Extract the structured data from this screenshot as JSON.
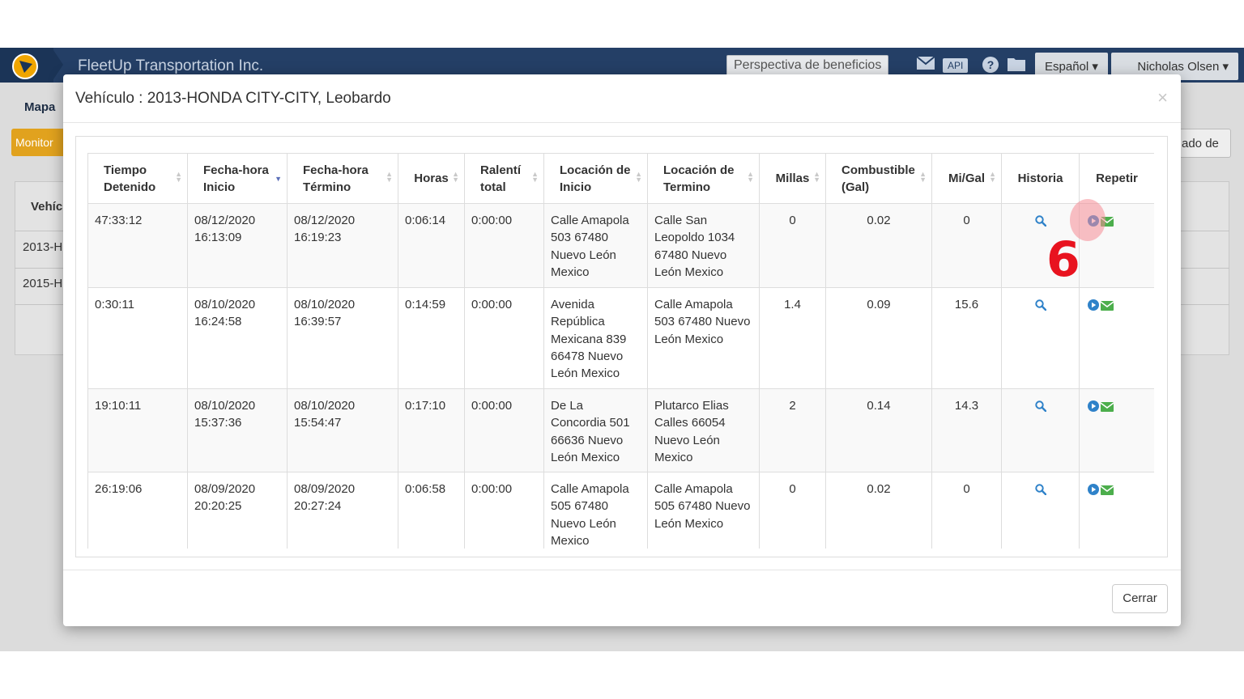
{
  "app": {
    "company": "FleetUp Transportation Inc.",
    "benefits_label": "Perspectiva de beneficios",
    "api_label": "API",
    "language": "Español",
    "user": "Nicholas Olsen",
    "tab_map": "Mapa",
    "monitor_btn": "Monitor",
    "right_btn": "ado de",
    "vehicle_col": "Vehíc",
    "rows": [
      "2013-H",
      "2015-H"
    ]
  },
  "modal": {
    "title": "Vehículo : 2013-HONDA CITY-CITY, Leobardo",
    "close_x": "×",
    "close_button": "Cerrar",
    "step_number": "6"
  },
  "table": {
    "headers": [
      "Tiempo Detenido",
      "Fecha-hora Inicio",
      "Fecha-hora Término",
      "Horas",
      "Ralentí total",
      "Locación de Inicio",
      "Locación de Termino",
      "Millas",
      "Combustible (Gal)",
      "Mi/Gal",
      "Historia",
      "Repetir"
    ],
    "rows": [
      {
        "stopped": "47:33:12",
        "start": "08/12/2020 16:13:09",
        "end": "08/12/2020 16:19:23",
        "hours": "0:06:14",
        "idle": "0:00:00",
        "start_loc": "Calle Amapola 503 67480 Nuevo León Mexico",
        "end_loc": "Calle San Leopoldo 1034 67480 Nuevo León Mexico",
        "miles": "0",
        "fuel": "0.02",
        "mpg": "0"
      },
      {
        "stopped": "0:30:11",
        "start": "08/10/2020 16:24:58",
        "end": "08/10/2020 16:39:57",
        "hours": "0:14:59",
        "idle": "0:00:00",
        "start_loc": "Avenida República Mexicana 839 66478 Nuevo León Mexico",
        "end_loc": "Calle Amapola 503 67480 Nuevo León Mexico",
        "miles": "1.4",
        "fuel": "0.09",
        "mpg": "15.6"
      },
      {
        "stopped": "19:10:11",
        "start": "08/10/2020 15:37:36",
        "end": "08/10/2020 15:54:47",
        "hours": "0:17:10",
        "idle": "0:00:00",
        "start_loc": "De La Concordia 501 66636 Nuevo León Mexico",
        "end_loc": "Plutarco Elias Calles 66054 Nuevo León Mexico",
        "miles": "2",
        "fuel": "0.14",
        "mpg": "14.3"
      },
      {
        "stopped": "26:19:06",
        "start": "08/09/2020 20:20:25",
        "end": "08/09/2020 20:27:24",
        "hours": "0:06:58",
        "idle": "0:00:00",
        "start_loc": "Calle Amapola 505 67480 Nuevo León Mexico",
        "end_loc": "Calle Amapola 505 67480 Nuevo León Mexico",
        "miles": "0",
        "fuel": "0.02",
        "mpg": "0"
      }
    ]
  },
  "colors": {
    "topbar": "#243f66",
    "accent_blue": "#2f82c9",
    "mail_green": "#4cae4c",
    "step_red": "#e8131f",
    "monitor_orange": "#e1a21e"
  },
  "icons": [
    "logo-icon",
    "mail-icon",
    "help-icon",
    "folder-icon",
    "search-icon",
    "play-icon",
    "envelope-icon",
    "sort-icon"
  ]
}
